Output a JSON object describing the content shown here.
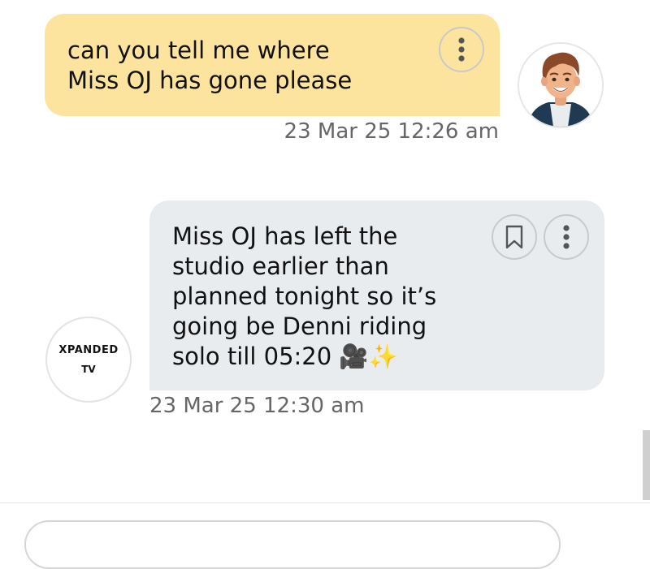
{
  "messages": [
    {
      "sender": "user",
      "text": "can you tell me where\nMiss OJ has gone please",
      "timestamp": "23 Mar 25 12:26 am",
      "actions": [
        "more-options-icon"
      ]
    },
    {
      "sender": "bot",
      "text": "Miss OJ has left the\nstudio earlier than\nplanned tonight so it’s\ngoing be Denni riding\nsolo till 05:20 🎥✨",
      "timestamp": "23 Mar 25 12:30 am",
      "actions": [
        "bookmark-icon",
        "more-options-icon"
      ]
    }
  ],
  "bot_avatar": {
    "line1": "XPANDED",
    "line2": "TV"
  },
  "colors": {
    "user_bubble": "#fde49e",
    "bot_bubble": "#e9ecef",
    "timestamp": "#666666",
    "text": "#111111"
  }
}
